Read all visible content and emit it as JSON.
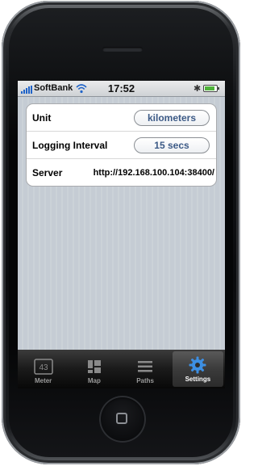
{
  "status_bar": {
    "carrier": "SoftBank",
    "time": "17:52",
    "bluetooth_icon": "bluetooth-icon",
    "battery_icon": "battery-icon",
    "wifi_icon": "wifi-icon"
  },
  "settings": {
    "rows": [
      {
        "label": "Unit",
        "value": "kilometers",
        "type": "picker"
      },
      {
        "label": "Logging Interval",
        "value": "15 secs",
        "type": "picker"
      },
      {
        "label": "Server",
        "value": "http://192.168.100.104:38400/",
        "type": "text"
      }
    ]
  },
  "tab_bar": {
    "tabs": [
      {
        "label": "Meter",
        "icon": "meter-icon",
        "active": false,
        "icon_text": "43"
      },
      {
        "label": "Map",
        "icon": "map-icon",
        "active": false
      },
      {
        "label": "Paths",
        "icon": "list-icon",
        "active": false
      },
      {
        "label": "Settings",
        "icon": "gear-icon",
        "active": true
      }
    ]
  },
  "colors": {
    "accent_blue": "#3c5a86",
    "group_background": "#c5ccd4",
    "signal_blue": "#1f63c8",
    "battery_green": "#4fb33a",
    "tab_bar": "#1a1a1a",
    "active_tab_icon": "#3d8fe3"
  }
}
